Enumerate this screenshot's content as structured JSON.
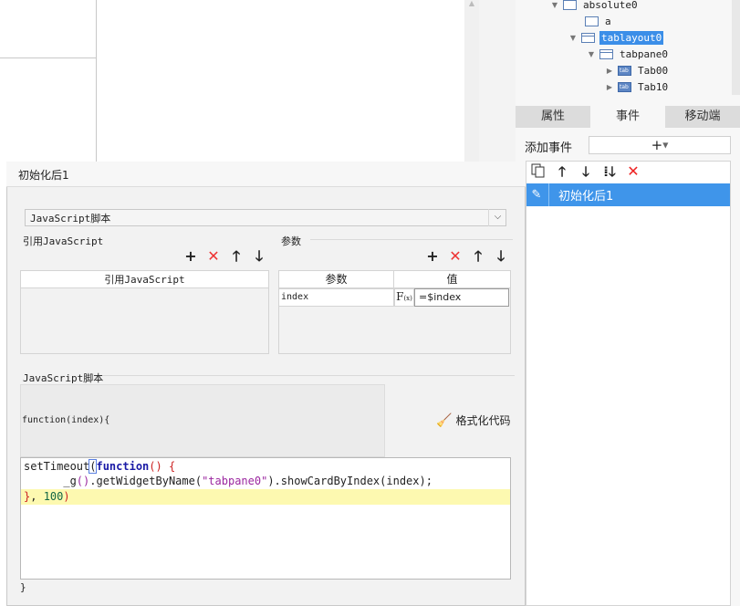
{
  "tree": {
    "items": [
      {
        "label": "absolute0",
        "expanded": true,
        "selected": false
      },
      {
        "label": "a",
        "selected": false
      },
      {
        "label": "tablayout0",
        "expanded": true,
        "selected": true
      },
      {
        "label": "tabpane0",
        "expanded": true,
        "selected": false
      },
      {
        "label": "Tab00",
        "expanded": false,
        "selected": false
      },
      {
        "label": "Tab10",
        "expanded": false,
        "selected": false
      }
    ]
  },
  "right_tabs": [
    {
      "label": "属性",
      "active": false
    },
    {
      "label": "事件",
      "active": true
    },
    {
      "label": "移动端",
      "active": false
    }
  ],
  "events": {
    "add_label": "添加事件",
    "add_button": "+",
    "toolbar": {
      "copy": "copy-icon",
      "up": "arrow-up-icon",
      "down": "arrow-down-icon",
      "bottom": "move-bottom-icon",
      "delete": "delete-icon"
    },
    "items": [
      {
        "label": "初始化后1",
        "selected": true
      }
    ]
  },
  "dialog": {
    "title": "初始化后1",
    "type_select": "JavaScript脚本",
    "ref_section_label": "引用JavaScript",
    "ref_table_header": "引用JavaScript",
    "param_section_label": "参数",
    "param_headers": [
      "参数",
      "值"
    ],
    "param_rows": [
      {
        "name": "index",
        "fx": "F(x)",
        "value": "=$index"
      }
    ],
    "script_section_label": "JavaScript脚本",
    "function_header": "function(index){",
    "format_button": "格式化代码",
    "footer": "}",
    "code": {
      "line1_a": "setTimeout",
      "line1_b": "(",
      "line1_c": "function",
      "line1_d": "() {",
      "line2_a": "      _g",
      "line2_b": "()",
      "line2_c": ".getWidgetByName(",
      "line2_d": "\"tabpane0\"",
      "line2_e": ").showCardByIndex(",
      "line2_f": "index",
      "line2_g": ");",
      "line3_a": "}",
      "line3_b": ", ",
      "line3_c": "100",
      "line3_d": ")"
    }
  }
}
